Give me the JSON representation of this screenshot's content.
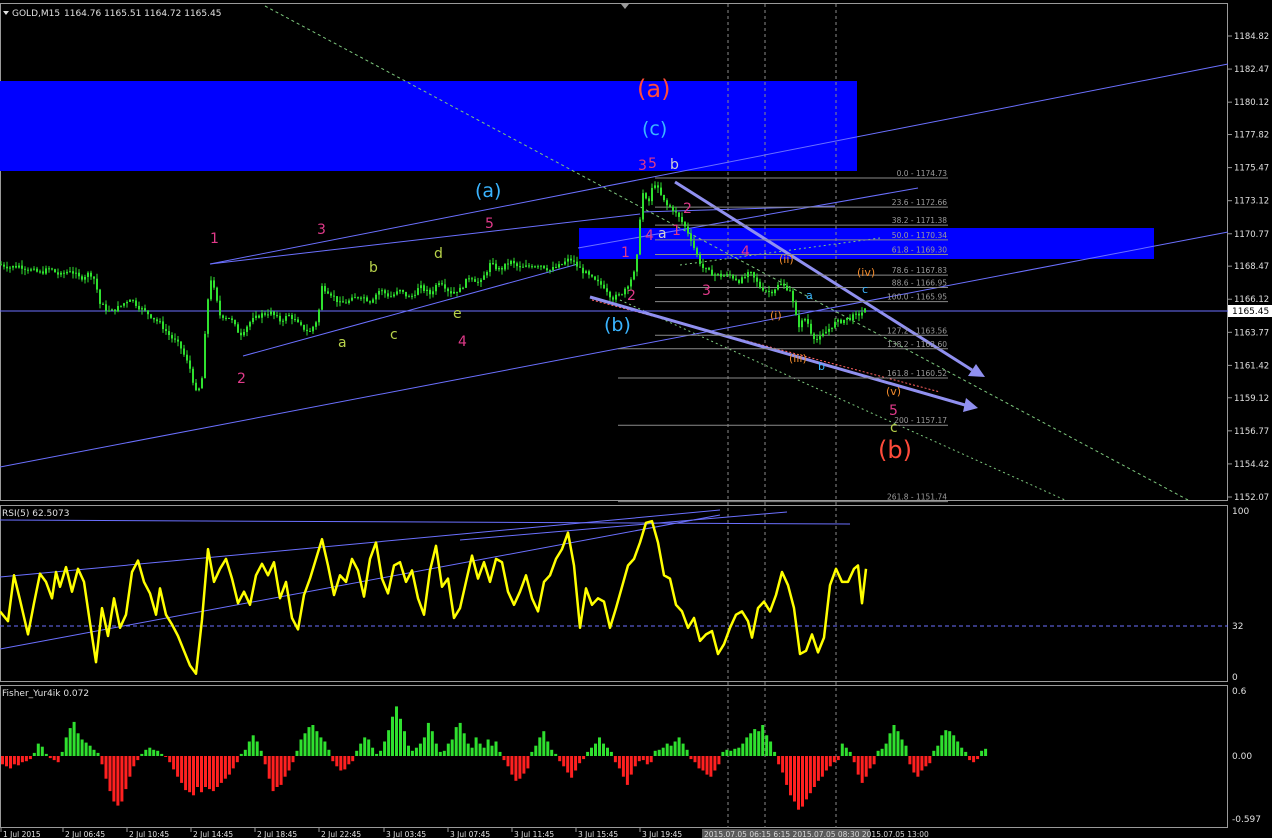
{
  "window": {
    "symbol_title": "GOLD,M15",
    "ohlc": "1164.76 1165.51 1164.72 1165.45",
    "current_price": "1165.45"
  },
  "colors": {
    "background": "#000000",
    "bull": "#2fe02f",
    "bear": "#ff2020",
    "rsi_line": "#ffff00",
    "trend_line": "#6b70ff",
    "zone_fill": "#0000ff",
    "wave_magenta": "#ff2b87",
    "wave_cyan": "#3ab4ff",
    "wave_red": "#ff4b3a",
    "wave_yellowgreen": "#b8d24a",
    "wave_orange": "#f08a2c",
    "fib_text": "#9a9a9a",
    "axis_text": "#e0e0e0"
  },
  "price_axis": {
    "ticks": [
      "1184.82",
      "1182.47",
      "1180.12",
      "1177.82",
      "1175.47",
      "1173.12",
      "1170.77",
      "1168.47",
      "1166.12",
      "1163.77",
      "1161.42",
      "1159.12",
      "1156.77",
      "1154.42",
      "1152.07"
    ]
  },
  "time_axis": {
    "labels": [
      "1 Jul 2015",
      "2 Jul 06:45",
      "2 Jul 10:45",
      "2 Jul 14:45",
      "2 Jul 18:45",
      "2 Jul 22:45",
      "3 Jul 03:45",
      "3 Jul 07:45",
      "3 Jul 11:45",
      "3 Jul 15:45",
      "3 Jul 19:45"
    ],
    "highlight_label": "2015.07.05 06:15 6:15  2015.07.05 08:30 2015.07.05 13:00"
  },
  "fib_levels": [
    {
      "ratio": "0.0",
      "price": "1174.73"
    },
    {
      "ratio": "23.6",
      "price": "1172.66"
    },
    {
      "ratio": "38.2",
      "price": "1171.38"
    },
    {
      "ratio": "50.0",
      "price": "1170.34"
    },
    {
      "ratio": "61.8",
      "price": "1169.30"
    },
    {
      "ratio": "78.6",
      "price": "1167.83"
    },
    {
      "ratio": "88.6",
      "price": "1166.95"
    },
    {
      "ratio": "100.0",
      "price": "1165.95"
    },
    {
      "ratio": "127.2",
      "price": "1163.56"
    },
    {
      "ratio": "138.2",
      "price": "1162.60"
    },
    {
      "ratio": "161.8",
      "price": "1160.52"
    },
    {
      "ratio": "200",
      "price": "1157.17"
    },
    {
      "ratio": "261.8",
      "price": "1151.74"
    }
  ],
  "wave_labels": {
    "big_a": "(a)",
    "big_c": "(c)",
    "cyan_a": "(a)",
    "cyan_b": "(b)",
    "big_b": "(b)",
    "m1": "1",
    "m2": "2",
    "m3": "3",
    "m4": "4",
    "m5": "5",
    "m3b": "3",
    "m5b": "5",
    "m4b": "4",
    "m1b": "1",
    "m2b": "2",
    "m2c": "2",
    "m4c": "4",
    "m3c": "3",
    "m5c": "5",
    "ya": "a",
    "yb": "b",
    "yc": "c",
    "yd": "d",
    "ye": "e",
    "wa": "a",
    "wb": "b",
    "oi": "(i)",
    "oii": "(ii)",
    "oiii": "(iii)",
    "oiv": "(iv)",
    "ov": "(v)",
    "ca": "a",
    "cb": "b",
    "cc": "c",
    "gc": "c"
  },
  "rsi_panel": {
    "label": "RSI(5) 62.5073",
    "ticks": [
      "100",
      "32",
      "0"
    ]
  },
  "fisher_panel": {
    "label": "Fisher_Yur4ik 0.072",
    "ticks": [
      "0.6",
      "0.00",
      "-0.597"
    ]
  },
  "chart_data": [
    {
      "type": "candlestick",
      "title": "GOLD,M15",
      "ylim": [
        1152.07,
        1186.0
      ],
      "y_ticks": [
        1184.82,
        1182.47,
        1180.12,
        1177.82,
        1175.47,
        1173.12,
        1170.77,
        1168.47,
        1166.12,
        1163.77,
        1161.42,
        1159.12,
        1156.77,
        1154.42,
        1152.07
      ],
      "close_path": [
        [
          0,
          1168.6
        ],
        [
          10,
          1168.4
        ],
        [
          20,
          1168.5
        ],
        [
          30,
          1168.2
        ],
        [
          40,
          1168.0
        ],
        [
          50,
          1168.3
        ],
        [
          60,
          1167.8
        ],
        [
          70,
          1168.2
        ],
        [
          80,
          1167.6
        ],
        [
          90,
          1168.0
        ],
        [
          95,
          1167.5
        ],
        [
          100,
          1165.8
        ],
        [
          110,
          1165.2
        ],
        [
          120,
          1165.6
        ],
        [
          130,
          1166.2
        ],
        [
          140,
          1165.5
        ],
        [
          150,
          1165.0
        ],
        [
          160,
          1164.4
        ],
        [
          170,
          1163.5
        ],
        [
          180,
          1162.8
        ],
        [
          190,
          1161.2
        ],
        [
          197,
          1159.2
        ],
        [
          202,
          1160.5
        ],
        [
          206,
          1164.5
        ],
        [
          210,
          1167.8
        ],
        [
          214,
          1166.8
        ],
        [
          220,
          1165.0
        ],
        [
          230,
          1164.8
        ],
        [
          240,
          1163.6
        ],
        [
          250,
          1164.5
        ],
        [
          260,
          1165.0
        ],
        [
          270,
          1165.2
        ],
        [
          280,
          1164.6
        ],
        [
          290,
          1165.0
        ],
        [
          300,
          1164.2
        ],
        [
          310,
          1163.8
        ],
        [
          318,
          1164.8
        ],
        [
          322,
          1167.0
        ],
        [
          330,
          1166.6
        ],
        [
          340,
          1165.8
        ],
        [
          350,
          1166.0
        ],
        [
          360,
          1166.4
        ],
        [
          370,
          1166.0
        ],
        [
          380,
          1166.8
        ],
        [
          390,
          1166.3
        ],
        [
          400,
          1166.7
        ],
        [
          410,
          1166.2
        ],
        [
          420,
          1167.0
        ],
        [
          430,
          1166.5
        ],
        [
          440,
          1167.5
        ],
        [
          450,
          1166.6
        ],
        [
          460,
          1166.8
        ],
        [
          470,
          1167.8
        ],
        [
          480,
          1167.2
        ],
        [
          490,
          1168.6
        ],
        [
          500,
          1168.2
        ],
        [
          510,
          1168.8
        ],
        [
          520,
          1168.3
        ],
        [
          530,
          1168.5
        ],
        [
          540,
          1168.6
        ],
        [
          550,
          1168.2
        ],
        [
          560,
          1168.5
        ],
        [
          570,
          1169.0
        ],
        [
          578,
          1168.4
        ],
        [
          585,
          1168.0
        ],
        [
          595,
          1167.4
        ],
        [
          605,
          1167.0
        ],
        [
          612,
          1166.2
        ],
        [
          620,
          1166.4
        ],
        [
          628,
          1167.2
        ],
        [
          636,
          1168.2
        ],
        [
          642,
          1173.8
        ],
        [
          648,
          1172.8
        ],
        [
          654,
          1174.5
        ],
        [
          660,
          1173.6
        ],
        [
          666,
          1172.8
        ],
        [
          672,
          1172.6
        ],
        [
          678,
          1172.0
        ],
        [
          684,
          1171.4
        ],
        [
          690,
          1170.6
        ],
        [
          696,
          1169.4
        ],
        [
          702,
          1168.4
        ],
        [
          710,
          1168.0
        ],
        [
          720,
          1167.8
        ],
        [
          730,
          1167.8
        ],
        [
          740,
          1167.4
        ],
        [
          750,
          1168.0
        ],
        [
          760,
          1167.0
        ],
        [
          770,
          1166.6
        ],
        [
          780,
          1167.2
        ],
        [
          790,
          1166.8
        ],
        [
          798,
          1164.2
        ],
        [
          806,
          1164.8
        ],
        [
          812,
          1163.6
        ],
        [
          818,
          1163.2
        ],
        [
          826,
          1163.8
        ],
        [
          834,
          1164.4
        ],
        [
          842,
          1164.6
        ],
        [
          850,
          1164.8
        ],
        [
          858,
          1165.0
        ],
        [
          866,
          1165.4
        ]
      ]
    },
    {
      "type": "line",
      "title": "RSI(5) 62.5073",
      "ylim": [
        0,
        100
      ],
      "y_ticks": [
        100,
        32,
        0
      ],
      "points": [
        [
          0,
          40
        ],
        [
          8,
          34
        ],
        [
          14,
          62
        ],
        [
          20,
          47
        ],
        [
          28,
          26
        ],
        [
          34,
          45
        ],
        [
          40,
          63
        ],
        [
          46,
          58
        ],
        [
          52,
          48
        ],
        [
          56,
          64
        ],
        [
          60,
          55
        ],
        [
          66,
          67
        ],
        [
          72,
          52
        ],
        [
          78,
          66
        ],
        [
          84,
          58
        ],
        [
          90,
          33
        ],
        [
          96,
          9
        ],
        [
          102,
          42
        ],
        [
          108,
          25
        ],
        [
          114,
          48
        ],
        [
          120,
          30
        ],
        [
          126,
          38
        ],
        [
          132,
          64
        ],
        [
          138,
          71
        ],
        [
          144,
          58
        ],
        [
          150,
          51
        ],
        [
          156,
          38
        ],
        [
          160,
          54
        ],
        [
          166,
          38
        ],
        [
          172,
          32
        ],
        [
          178,
          25
        ],
        [
          184,
          16
        ],
        [
          190,
          7
        ],
        [
          196,
          2
        ],
        [
          202,
          35
        ],
        [
          208,
          78
        ],
        [
          214,
          58
        ],
        [
          220,
          66
        ],
        [
          226,
          72
        ],
        [
          232,
          60
        ],
        [
          238,
          45
        ],
        [
          244,
          52
        ],
        [
          250,
          44
        ],
        [
          256,
          62
        ],
        [
          262,
          69
        ],
        [
          268,
          62
        ],
        [
          274,
          70
        ],
        [
          280,
          48
        ],
        [
          286,
          58
        ],
        [
          292,
          36
        ],
        [
          298,
          29
        ],
        [
          304,
          50
        ],
        [
          310,
          60
        ],
        [
          316,
          72
        ],
        [
          322,
          84
        ],
        [
          328,
          68
        ],
        [
          334,
          50
        ],
        [
          340,
          62
        ],
        [
          346,
          58
        ],
        [
          352,
          72
        ],
        [
          358,
          65
        ],
        [
          364,
          49
        ],
        [
          370,
          72
        ],
        [
          376,
          82
        ],
        [
          382,
          60
        ],
        [
          388,
          51
        ],
        [
          394,
          68
        ],
        [
          400,
          70
        ],
        [
          406,
          58
        ],
        [
          412,
          65
        ],
        [
          418,
          48
        ],
        [
          424,
          38
        ],
        [
          430,
          65
        ],
        [
          436,
          80
        ],
        [
          442,
          55
        ],
        [
          448,
          60
        ],
        [
          454,
          36
        ],
        [
          460,
          42
        ],
        [
          466,
          58
        ],
        [
          472,
          74
        ],
        [
          478,
          60
        ],
        [
          484,
          70
        ],
        [
          490,
          58
        ],
        [
          496,
          72
        ],
        [
          502,
          70
        ],
        [
          508,
          52
        ],
        [
          514,
          44
        ],
        [
          520,
          52
        ],
        [
          526,
          62
        ],
        [
          532,
          48
        ],
        [
          538,
          40
        ],
        [
          544,
          58
        ],
        [
          550,
          62
        ],
        [
          556,
          72
        ],
        [
          562,
          78
        ],
        [
          568,
          88
        ],
        [
          574,
          68
        ],
        [
          580,
          30
        ],
        [
          586,
          54
        ],
        [
          592,
          44
        ],
        [
          598,
          48
        ],
        [
          604,
          46
        ],
        [
          610,
          30
        ],
        [
          616,
          42
        ],
        [
          622,
          55
        ],
        [
          628,
          68
        ],
        [
          634,
          72
        ],
        [
          640,
          82
        ],
        [
          646,
          94
        ],
        [
          652,
          95
        ],
        [
          658,
          82
        ],
        [
          664,
          62
        ],
        [
          670,
          60
        ],
        [
          676,
          44
        ],
        [
          682,
          40
        ],
        [
          688,
          30
        ],
        [
          694,
          36
        ],
        [
          700,
          22
        ],
        [
          706,
          26
        ],
        [
          712,
          28
        ],
        [
          718,
          14
        ],
        [
          724,
          20
        ],
        [
          730,
          30
        ],
        [
          736,
          38
        ],
        [
          742,
          40
        ],
        [
          748,
          34
        ],
        [
          752,
          24
        ],
        [
          758,
          42
        ],
        [
          764,
          46
        ],
        [
          770,
          40
        ],
        [
          776,
          50
        ],
        [
          782,
          64
        ],
        [
          788,
          56
        ],
        [
          794,
          42
        ],
        [
          800,
          14
        ],
        [
          806,
          16
        ],
        [
          812,
          26
        ],
        [
          818,
          15
        ],
        [
          824,
          24
        ],
        [
          830,
          56
        ],
        [
          836,
          66
        ],
        [
          842,
          58
        ],
        [
          848,
          58
        ],
        [
          854,
          66
        ],
        [
          858,
          68
        ],
        [
          862,
          45
        ],
        [
          866,
          66
        ]
      ]
    },
    {
      "type": "bar",
      "title": "Fisher_Yur4ik 0.072",
      "ylim": [
        -0.597,
        0.6
      ],
      "y_ticks": [
        0.6,
        0.0,
        -0.597
      ],
      "values": [
        -0.08,
        -0.1,
        -0.12,
        -0.08,
        -0.09,
        -0.06,
        -0.05,
        -0.03,
        0.03,
        0.12,
        0.09,
        0.02,
        -0.02,
        -0.04,
        -0.06,
        0.04,
        0.18,
        0.27,
        0.33,
        0.22,
        0.16,
        0.13,
        0.1,
        0.06,
        0.03,
        -0.08,
        -0.22,
        -0.34,
        -0.44,
        -0.48,
        -0.44,
        -0.32,
        -0.2,
        -0.1,
        -0.04,
        0.02,
        0.06,
        0.08,
        0.06,
        0.05,
        0.02,
        -0.01,
        -0.06,
        -0.13,
        -0.2,
        -0.26,
        -0.33,
        -0.35,
        -0.38,
        -0.3,
        -0.35,
        -0.3,
        -0.32,
        -0.34,
        -0.3,
        -0.26,
        -0.22,
        -0.18,
        -0.12,
        -0.06,
        0.02,
        0.06,
        0.14,
        0.2,
        0.14,
        0.05,
        -0.08,
        -0.22,
        -0.34,
        -0.3,
        -0.28,
        -0.2,
        -0.14,
        -0.06,
        0.05,
        0.16,
        0.22,
        0.28,
        0.3,
        0.24,
        0.18,
        0.14,
        0.06,
        -0.05,
        -0.1,
        -0.14,
        -0.13,
        -0.08,
        -0.05,
        0.05,
        0.12,
        0.18,
        0.16,
        0.08,
        0.02,
        0.05,
        0.14,
        0.25,
        0.38,
        0.48,
        0.36,
        0.24,
        0.1,
        0.05,
        0.08,
        0.12,
        0.18,
        0.32,
        0.24,
        0.12,
        0.04,
        0.05,
        0.12,
        0.16,
        0.28,
        0.32,
        0.22,
        0.12,
        0.08,
        0.18,
        0.12,
        0.08,
        0.16,
        0.1,
        0.14,
        0.04,
        -0.04,
        -0.1,
        -0.18,
        -0.24,
        -0.22,
        -0.17,
        -0.12,
        0.04,
        0.1,
        0.18,
        0.24,
        0.14,
        0.06,
        0.02,
        -0.05,
        -0.1,
        -0.16,
        -0.21,
        -0.14,
        -0.07,
        -0.03,
        0.04,
        0.08,
        0.12,
        0.18,
        0.12,
        0.08,
        0.04,
        -0.06,
        -0.12,
        -0.2,
        -0.28,
        -0.18,
        -0.1,
        -0.05,
        -0.04,
        -0.08,
        -0.06,
        0.05,
        0.06,
        0.08,
        0.12,
        0.1,
        0.14,
        0.18,
        0.12,
        0.06,
        -0.03,
        -0.06,
        -0.12,
        -0.14,
        -0.18,
        -0.2,
        -0.14,
        -0.08,
        0.04,
        0.06,
        0.05,
        0.07,
        0.08,
        0.12,
        0.18,
        0.22,
        0.26,
        0.24,
        0.3,
        0.2,
        0.14,
        0.04,
        -0.08,
        -0.16,
        -0.28,
        -0.38,
        -0.44,
        -0.52,
        -0.49,
        -0.42,
        -0.36,
        -0.3,
        -0.24,
        -0.2,
        -0.14,
        -0.1,
        -0.06,
        -0.04,
        0.12,
        0.08,
        0.04,
        -0.06,
        -0.18,
        -0.26,
        -0.2,
        -0.12,
        -0.08,
        0.05,
        0.07,
        0.12,
        0.22,
        0.3,
        0.24,
        0.16,
        0.1,
        -0.08,
        -0.16,
        -0.2,
        -0.14,
        -0.1,
        -0.07,
        0.05,
        0.1,
        0.2,
        0.25,
        0.24,
        0.2,
        0.14,
        0.08,
        0.04,
        -0.04,
        -0.06,
        -0.03,
        0.05,
        0.07
      ]
    }
  ]
}
